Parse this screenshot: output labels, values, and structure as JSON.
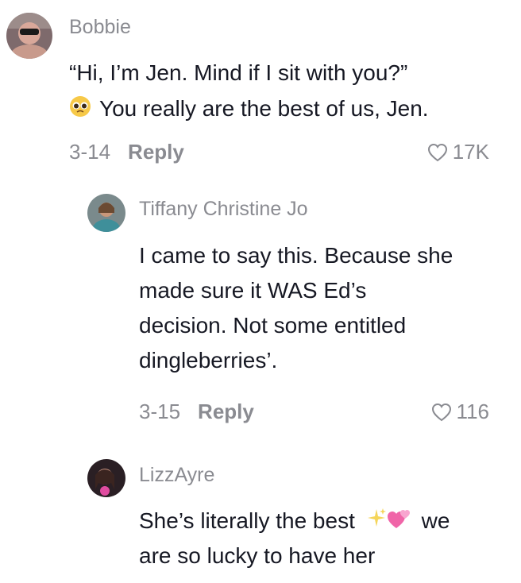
{
  "comments": [
    {
      "username": "Bobbie",
      "text_lines": [
        "“Hi, I’m Jen. Mind if I sit with you?”",
        "You really are the best of us, Jen."
      ],
      "emoji_icon": "pleading-face-icon",
      "date": "3-14",
      "reply_label": "Reply",
      "likes": "17K"
    },
    {
      "username": "Tiffany Christine Jo",
      "text_lines": [
        "I came to say this. Because she",
        "made sure it WAS Ed’s",
        "decision. Not some entitled",
        "dingleberries’."
      ],
      "date": "3-15",
      "reply_label": "Reply",
      "likes": "116"
    },
    {
      "username": "LizzAyre",
      "text_lines": [
        "She’s literally the best",
        "we",
        "are so lucky to have her"
      ],
      "emoji_icons": [
        "sparkles-icon",
        "two-hearts-icon"
      ]
    }
  ],
  "colors": {
    "text": "#161823",
    "secondary": "#8a8b91",
    "background": "#ffffff"
  }
}
